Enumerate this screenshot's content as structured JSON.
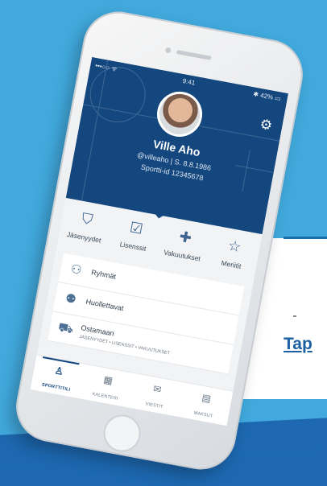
{
  "background": {
    "link_text": "Tap",
    "colors": {
      "sky": "#41a9dd",
      "band": "#1d68b0",
      "link": "#1b5fa3"
    }
  },
  "status_bar": {
    "signal": "•••○○ ᯤ",
    "time": "9:41",
    "battery": "✱ 42% ▭"
  },
  "profile": {
    "name": "Ville Aho",
    "handle_line": "@villeaho | S. 8.8.1986",
    "sportti_id": "Sportti-id 12345678"
  },
  "tiles": [
    {
      "label": "Jäsenyydet",
      "icon": "shield-icon"
    },
    {
      "label": "Lisenssit",
      "icon": "license-icon"
    },
    {
      "label": "Vakuutukset",
      "icon": "medical-cross-icon"
    },
    {
      "label": "Meriitit",
      "icon": "star-icon"
    }
  ],
  "list": [
    {
      "label": "Ryhmät",
      "icon": "group-icon"
    },
    {
      "label": "Huollettavat",
      "icon": "dependents-icon"
    },
    {
      "label": "Ostamaan",
      "sub": "JÄSENYYDET • LISENSSIT • VAKUUTUKSET",
      "icon": "cart-icon"
    }
  ],
  "tabbar": [
    {
      "label": "SPORTTITILI",
      "icon": "person-icon",
      "active": true
    },
    {
      "label": "KALENTERI",
      "icon": "calendar-icon"
    },
    {
      "label": "VIESTIT",
      "icon": "envelope-icon"
    },
    {
      "label": "MAKSUT",
      "icon": "wallet-icon"
    }
  ],
  "colors": {
    "header": "#14477e",
    "accent": "#14477e"
  }
}
